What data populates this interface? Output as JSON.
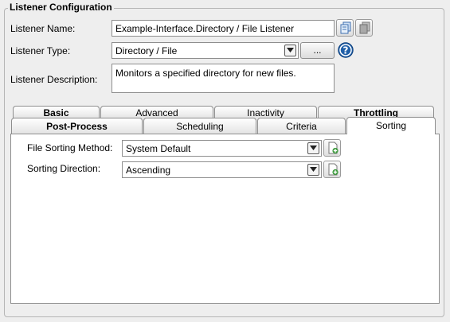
{
  "group_title": "Listener Configuration",
  "listener_name": {
    "label": "Listener Name:",
    "value": "Example-Interface.Directory / File Listener"
  },
  "listener_type": {
    "label": "Listener Type:",
    "value": "Directory / File",
    "browse_label": "..."
  },
  "listener_description": {
    "label": "Listener Description:",
    "value": "Monitors a specified directory for new files."
  },
  "tabs_back": [
    {
      "label": "Basic",
      "bold": true
    },
    {
      "label": "Advanced",
      "bold": false
    },
    {
      "label": "Inactivity",
      "bold": false
    },
    {
      "label": "Throttling",
      "bold": true
    }
  ],
  "tabs_front": [
    {
      "label": "Post-Process",
      "bold": true
    },
    {
      "label": "Scheduling",
      "bold": false
    },
    {
      "label": "Criteria",
      "bold": false
    },
    {
      "label": "Sorting",
      "bold": false,
      "selected": true
    }
  ],
  "sorting": {
    "method_label": "File Sorting Method:",
    "method_value": "System Default",
    "direction_label": "Sorting Direction:",
    "direction_value": "Ascending"
  },
  "colors": {
    "help_icon": "#1f5fa8",
    "add_icon": "#3c9a3c"
  },
  "icons": {
    "copy": "copy-icon",
    "paste": "paste-icon",
    "help": "help-icon",
    "add": "add-file-icon",
    "dropdown": "chevron-down-icon"
  }
}
